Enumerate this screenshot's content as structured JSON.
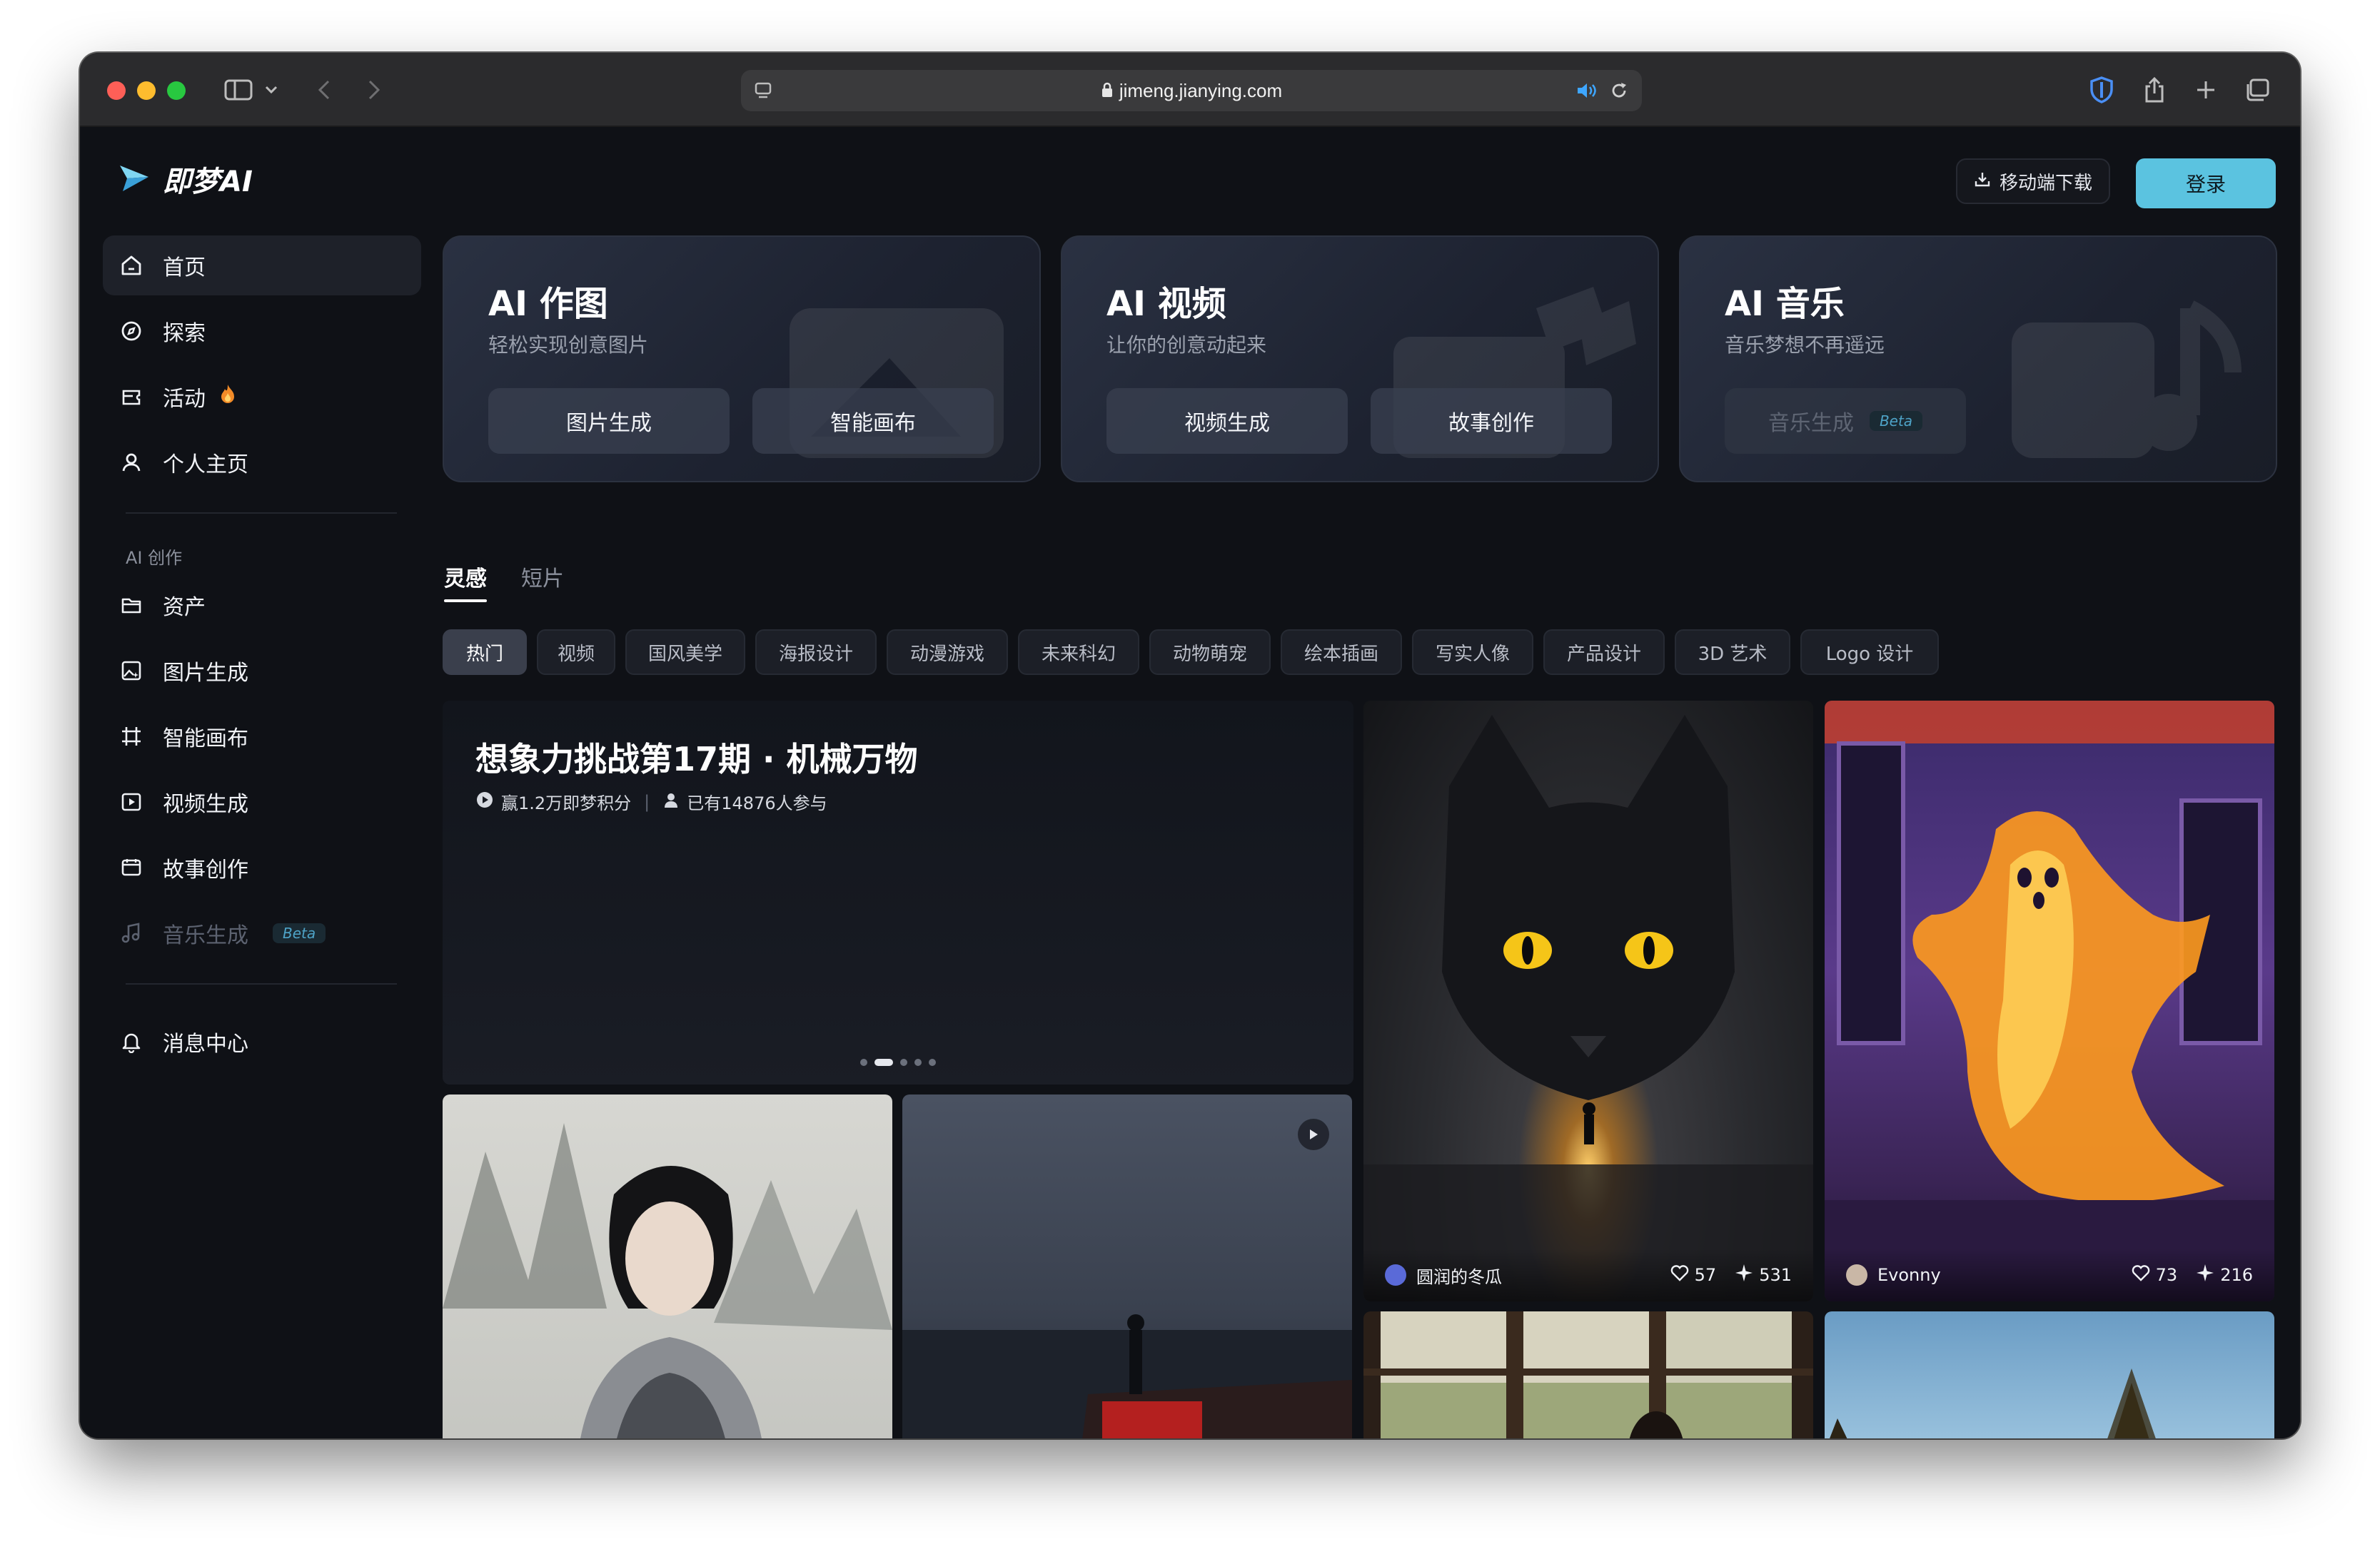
{
  "browser": {
    "url": "jimeng.jianying.com"
  },
  "logo": {
    "text": "即梦AI"
  },
  "sidebar": {
    "items": [
      {
        "label": "首页",
        "icon": "home-icon",
        "active": true
      },
      {
        "label": "探索",
        "icon": "compass-icon"
      },
      {
        "label": "活动",
        "icon": "activity-icon",
        "badge_icon": "fire-icon"
      },
      {
        "label": "个人主页",
        "icon": "user-icon"
      }
    ],
    "section_label": "AI 创作",
    "create_items": [
      {
        "label": "资产",
        "icon": "folder-icon"
      },
      {
        "label": "图片生成",
        "icon": "image-gen-icon"
      },
      {
        "label": "智能画布",
        "icon": "canvas-icon"
      },
      {
        "label": "视频生成",
        "icon": "video-gen-icon"
      },
      {
        "label": "故事创作",
        "icon": "story-icon"
      },
      {
        "label": "音乐生成",
        "icon": "music-icon",
        "badge": "Beta",
        "disabled": true
      }
    ],
    "message_center": {
      "label": "消息中心",
      "icon": "bell-icon"
    }
  },
  "header": {
    "download_label": "移动端下载",
    "login_label": "登录"
  },
  "cards": [
    {
      "title": "AI 作图",
      "subtitle": "轻松实现创意图片",
      "buttons": [
        "图片生成",
        "智能画布"
      ]
    },
    {
      "title": "AI 视频",
      "subtitle": "让你的创意动起来",
      "buttons": [
        "视频生成",
        "故事创作"
      ]
    },
    {
      "title": "AI 音乐",
      "subtitle": "音乐梦想不再遥远",
      "button": "音乐生成",
      "badge": "Beta"
    }
  ],
  "tabs": [
    "灵感",
    "短片"
  ],
  "chips": [
    "热门",
    "视频",
    "国风美学",
    "海报设计",
    "动漫游戏",
    "未来科幻",
    "动物萌宠",
    "绘本插画",
    "写实人像",
    "产品设计",
    "3D 艺术",
    "Logo 设计"
  ],
  "banner": {
    "title": "想象力挑战第17期 · 机械万物",
    "reward": "赢1.2万即梦积分",
    "participants": "已有14876人参与",
    "dot_count": 5,
    "active_dot": 1
  },
  "gallery": [
    {
      "author": "圆润的冬瓜",
      "likes": "57",
      "remixes": "531"
    },
    {
      "author": "Evonny",
      "likes": "73",
      "remixes": "216"
    }
  ],
  "colors": {
    "background": "#0f1116",
    "accent": "#5bc3e0",
    "card": "#222839",
    "beta": "#4ea3c7"
  }
}
